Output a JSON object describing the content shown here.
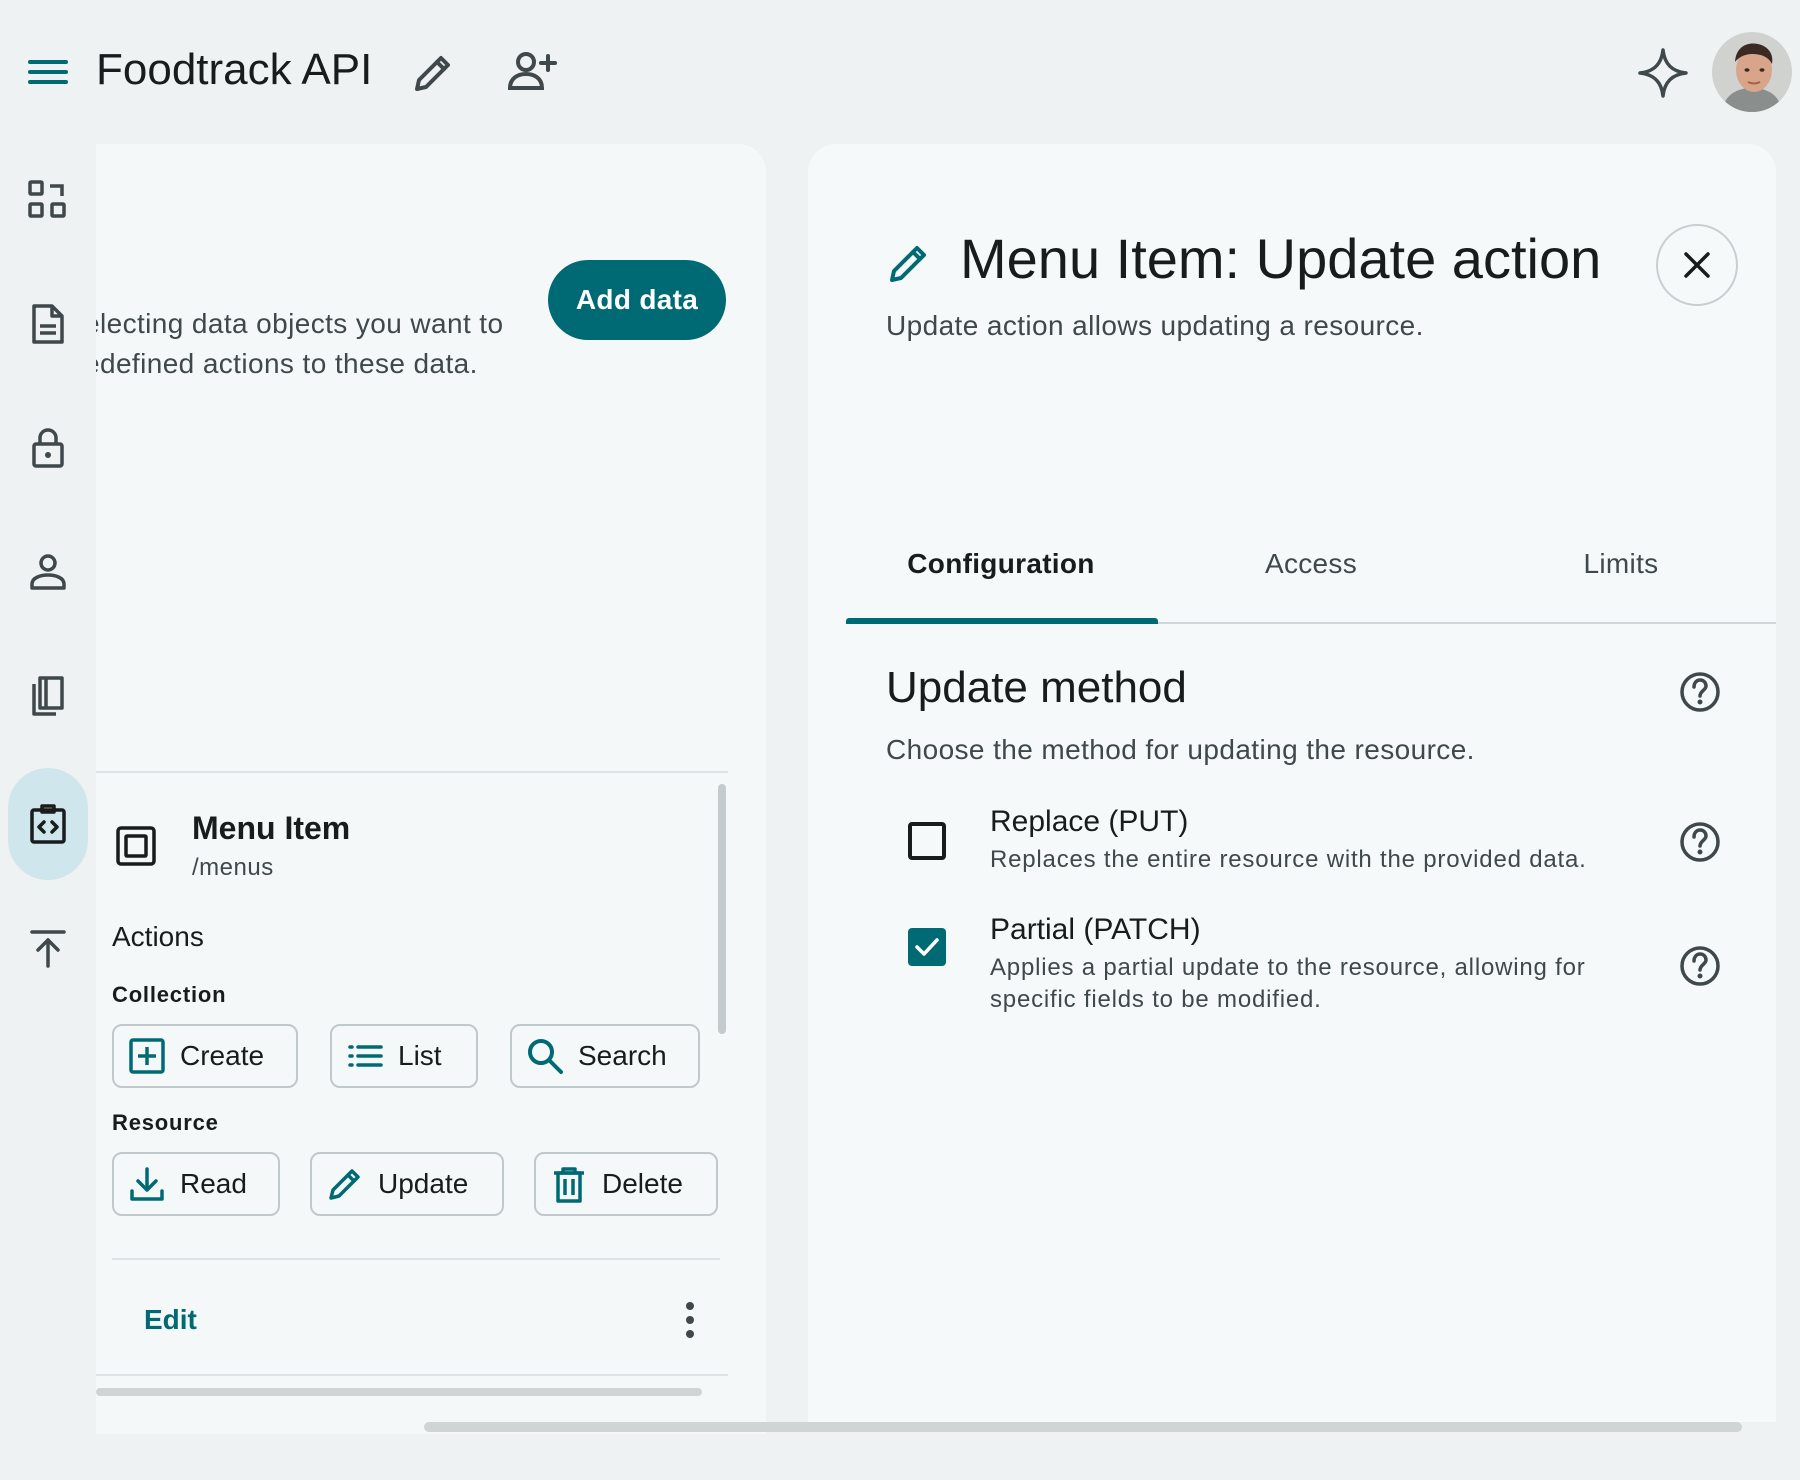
{
  "header": {
    "title": "Foodtrack API",
    "icons": {
      "menu": "menu-icon",
      "edit": "pencil-icon",
      "add_user": "person-add-icon",
      "ai": "sparkle-icon",
      "avatar": "user-avatar"
    }
  },
  "rail": {
    "items": [
      {
        "icon": "dashboard-icon",
        "active": false
      },
      {
        "icon": "document-icon",
        "active": false
      },
      {
        "icon": "lock-icon",
        "active": false
      },
      {
        "icon": "person-icon",
        "active": false
      },
      {
        "icon": "book-icon",
        "active": false
      },
      {
        "icon": "api-code-icon",
        "active": true
      },
      {
        "icon": "publish-icon",
        "active": false
      }
    ]
  },
  "left_panel": {
    "intro_line1": "electing data objects you want to",
    "intro_line2": "edefined actions to these data.",
    "add_data_label": "Add data",
    "entity": {
      "name": "Menu Item",
      "path": "/menus"
    },
    "actions_heading": "Actions",
    "collection_label": "Collection",
    "collection_actions": [
      {
        "label": "Create",
        "icon": "add-box-icon"
      },
      {
        "label": "List",
        "icon": "list-icon"
      },
      {
        "label": "Search",
        "icon": "search-icon"
      }
    ],
    "resource_label": "Resource",
    "resource_actions": [
      {
        "label": "Read",
        "icon": "download-icon"
      },
      {
        "label": "Update",
        "icon": "pencil-icon"
      },
      {
        "label": "Delete",
        "icon": "trash-icon"
      }
    ],
    "edit_label": "Edit"
  },
  "right_panel": {
    "title": "Menu Item: Update action",
    "subtitle": "Update action allows updating a resource.",
    "tabs": [
      {
        "label": "Configuration",
        "active": true
      },
      {
        "label": "Access",
        "active": false
      },
      {
        "label": "Limits",
        "active": false
      }
    ],
    "section": {
      "title": "Update method",
      "description": "Choose the method for updating the resource.",
      "options": [
        {
          "label": "Replace (PUT)",
          "description": "Replaces the entire resource with the provided data.",
          "checked": false
        },
        {
          "label": "Partial (PATCH)",
          "description": "Applies a partial update to the resource, allowing for specific fields to be modified.",
          "checked": true
        }
      ]
    }
  },
  "colors": {
    "accent": "#006a74",
    "rail_active": "#cfe6ec",
    "background": "#eef2f3",
    "surface": "#f5f9f9"
  }
}
